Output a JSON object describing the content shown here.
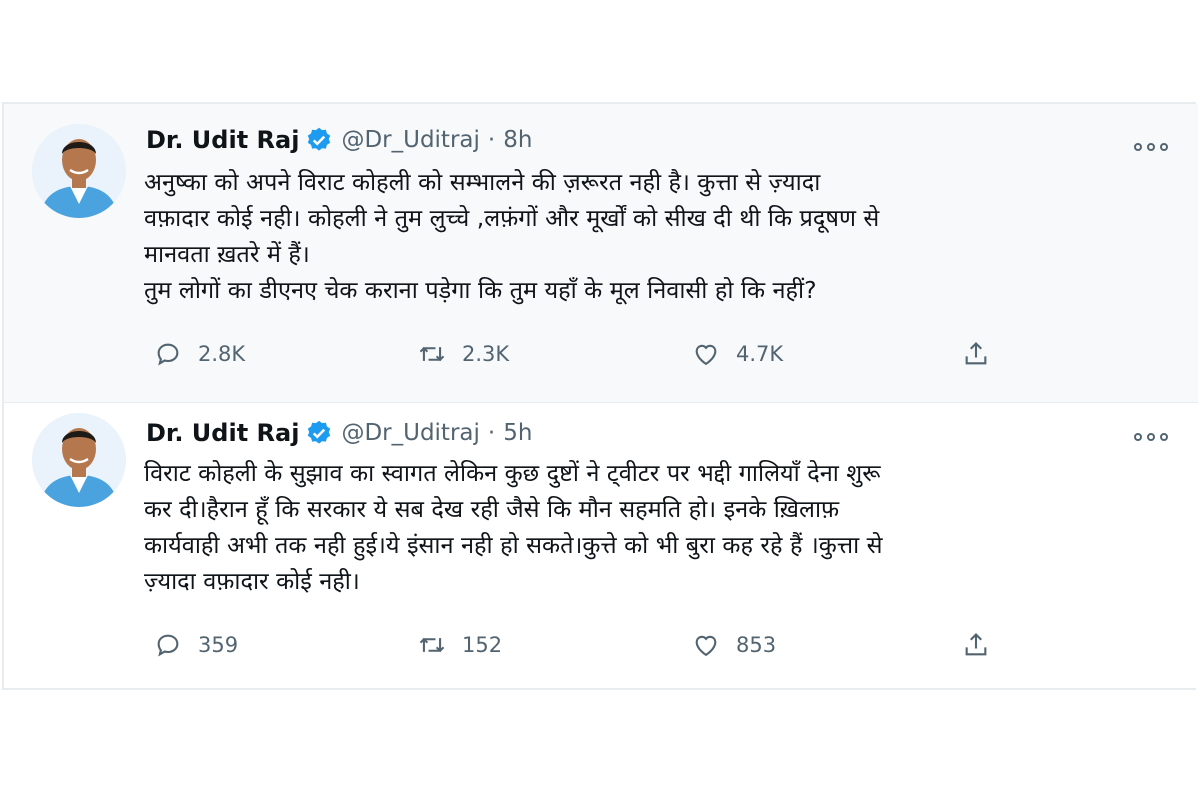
{
  "tweets": [
    {
      "name": "Dr. Udit Raj",
      "handle": "@Dr_Uditraj",
      "separator": "·",
      "time": "8h",
      "lines": [
        "अनुष्का को अपने     विराट कोहली को सम्भालने की ज़रूरत नही है। कुत्ता से ज़्यादा",
        "वफ़ादार कोई नही। कोहली ने तुम लुच्चे ,लफ़ंगों और मूर्खों को सीख दी थी कि प्रदूषण से",
        "मानवता ख़तरे में हैं।",
        "तुम लोगों का डीएनए चेक कराना पड़ेगा कि तुम यहाँ के मूल निवासी हो कि नहीं?"
      ],
      "replies": "2.8K",
      "retweets": "2.3K",
      "likes": "4.7K"
    },
    {
      "name": "Dr. Udit Raj",
      "handle": "@Dr_Uditraj",
      "separator": "·",
      "time": "5h",
      "lines": [
        "विराट कोहली के सुझाव का स्वागत  लेकिन कुछ दुष्टों ने ट्वीटर पर भद्दी गालियाँ देना शुरू",
        "कर दी।हैरान  हूँ कि सरकार ये सब देख रही जैसे कि मौन सहमति हो। इनके ख़िलाफ़",
        "कार्यवाही अभी तक नही हुई।ये इंसान नही हो सकते।कुत्ते को भी बुरा कह रहे हैं ।कुत्ता से",
        "ज़्यादा वफ़ादार कोई नही।"
      ],
      "replies": "359",
      "retweets": "152",
      "likes": "853"
    }
  ],
  "icons": {
    "verified": "verified-badge-icon",
    "more": "more-options-icon",
    "reply": "reply-icon",
    "retweet": "retweet-icon",
    "like": "heart-icon",
    "share": "share-icon"
  },
  "colors": {
    "verified_blue": "#1d9bf0",
    "text_primary": "#0f1419",
    "text_secondary": "#536471",
    "avatar_shirt": "#4aa3df"
  }
}
